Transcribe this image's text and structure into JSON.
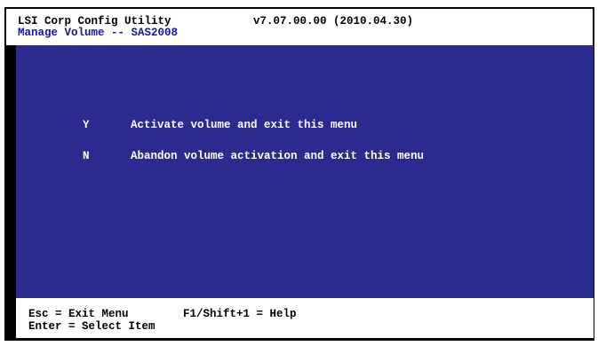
{
  "header": {
    "title": "LSI Corp Config Utility",
    "version": "v7.07.00.00 (2010.04.30)",
    "subtitle": "Manage Volume -- SAS2008"
  },
  "menu": {
    "items": [
      {
        "key": "Y",
        "label": "Activate volume and exit this menu"
      },
      {
        "key": "N",
        "label": "Abandon volume activation and exit this menu"
      }
    ]
  },
  "footer": {
    "esc_hint": "Esc = Exit Menu",
    "help_hint": "F1/Shift+1 = Help",
    "enter_hint": "Enter = Select Item"
  },
  "colors": {
    "main_background": "#2b2a8e",
    "subtitle_text": "#1515a8",
    "menu_text": "#ffffff"
  }
}
